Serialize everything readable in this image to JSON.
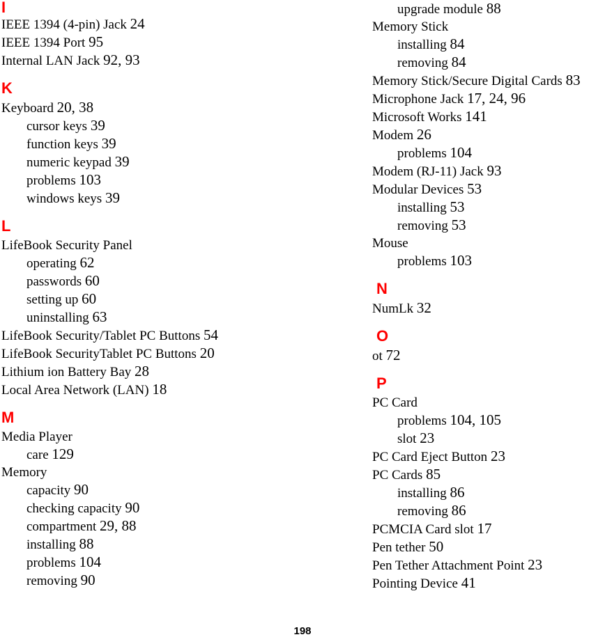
{
  "document": {
    "kind": "index-page",
    "page_number": "198",
    "accent_color": "#ff0000",
    "text_color": "#000000",
    "background_color": "#ffffff"
  },
  "columns": [
    {
      "name": "left-column",
      "continuation_entries": [],
      "sections": [
        {
          "letter": "I",
          "entries": [
            {
              "label": "IEEE 1394 (4-pin) Jack",
              "pages": "24",
              "sub": false
            },
            {
              "label": "IEEE 1394 Port",
              "pages": "95",
              "sub": false
            },
            {
              "label": "Internal LAN Jack",
              "pages": "92, 93",
              "sub": false
            }
          ]
        },
        {
          "letter": "K",
          "entries": [
            {
              "label": "Keyboard",
              "pages": "20, 38",
              "sub": false
            },
            {
              "label": "cursor keys",
              "pages": "39",
              "sub": true
            },
            {
              "label": "function keys",
              "pages": "39",
              "sub": true
            },
            {
              "label": "numeric keypad",
              "pages": "39",
              "sub": true
            },
            {
              "label": "problems",
              "pages": "103",
              "sub": true
            },
            {
              "label": "windows keys",
              "pages": "39",
              "sub": true
            }
          ]
        },
        {
          "letter": "L",
          "entries": [
            {
              "label": "LifeBook Security Panel",
              "pages": "",
              "sub": false
            },
            {
              "label": "operating",
              "pages": "62",
              "sub": true
            },
            {
              "label": "passwords",
              "pages": "60",
              "sub": true
            },
            {
              "label": "setting up",
              "pages": "60",
              "sub": true
            },
            {
              "label": "uninstalling",
              "pages": "63",
              "sub": true
            },
            {
              "label": "LifeBook Security/Tablet PC Buttons",
              "pages": "54",
              "sub": false
            },
            {
              "label": "LifeBook SecurityTablet PC Buttons",
              "pages": "20",
              "sub": false
            },
            {
              "label": "Lithium ion Battery Bay",
              "pages": "28",
              "sub": false
            },
            {
              "label": "Local Area Network (LAN)",
              "pages": "18",
              "sub": false
            }
          ]
        },
        {
          "letter": "M",
          "entries": [
            {
              "label": "Media Player",
              "pages": "",
              "sub": false
            },
            {
              "label": "care",
              "pages": "129",
              "sub": true
            },
            {
              "label": "Memory",
              "pages": "",
              "sub": false
            },
            {
              "label": "capacity",
              "pages": "90",
              "sub": true
            },
            {
              "label": "checking capacity",
              "pages": "90",
              "sub": true
            },
            {
              "label": "compartment",
              "pages": "29, 88",
              "sub": true
            },
            {
              "label": "installing",
              "pages": "88",
              "sub": true
            },
            {
              "label": "problems",
              "pages": "104",
              "sub": true
            },
            {
              "label": "removing",
              "pages": "90",
              "sub": true
            }
          ]
        }
      ]
    },
    {
      "name": "right-column",
      "continuation_entries": [
        {
          "label": "upgrade module",
          "pages": "88",
          "sub": true
        },
        {
          "label": "Memory Stick",
          "pages": "",
          "sub": false
        },
        {
          "label": "installing",
          "pages": "84",
          "sub": true
        },
        {
          "label": "removing",
          "pages": "84",
          "sub": true
        },
        {
          "label": "Memory Stick/Secure Digital Cards",
          "pages": "83",
          "sub": false
        },
        {
          "label": "Microphone Jack",
          "pages": "17, 24, 96",
          "sub": false
        },
        {
          "label": "Microsoft Works",
          "pages": "141",
          "sub": false
        },
        {
          "label": "Modem",
          "pages": "26",
          "sub": false
        },
        {
          "label": "problems",
          "pages": "104",
          "sub": true
        },
        {
          "label": "Modem (RJ-11) Jack",
          "pages": "93",
          "sub": false
        },
        {
          "label": "Modular Devices",
          "pages": "53",
          "sub": false
        },
        {
          "label": "installing",
          "pages": "53",
          "sub": true
        },
        {
          "label": "removing",
          "pages": "53",
          "sub": true
        },
        {
          "label": "Mouse",
          "pages": "",
          "sub": false
        },
        {
          "label": "problems",
          "pages": "103",
          "sub": true
        }
      ],
      "sections": [
        {
          "letter": "N",
          "entries": [
            {
              "label": "NumLk",
              "pages": "32",
              "sub": false
            }
          ]
        },
        {
          "letter": "O",
          "entries": [
            {
              "label": "ot",
              "pages": "72",
              "sub": false
            }
          ]
        },
        {
          "letter": "P",
          "entries": [
            {
              "label": "PC Card",
              "pages": "",
              "sub": false
            },
            {
              "label": "problems",
              "pages": "104, 105",
              "sub": true
            },
            {
              "label": "slot",
              "pages": "23",
              "sub": true
            },
            {
              "label": "PC Card Eject Button",
              "pages": "23",
              "sub": false
            },
            {
              "label": "PC Cards",
              "pages": "85",
              "sub": false
            },
            {
              "label": "installing",
              "pages": "86",
              "sub": true
            },
            {
              "label": "removing",
              "pages": "86",
              "sub": true
            },
            {
              "label": "PCMCIA Card slot",
              "pages": "17",
              "sub": false
            },
            {
              "label": "Pen tether",
              "pages": "50",
              "sub": false
            },
            {
              "label": "Pen Tether Attachment Point",
              "pages": "23",
              "sub": false
            },
            {
              "label": "Pointing Device",
              "pages": "41",
              "sub": false
            }
          ]
        }
      ]
    }
  ]
}
